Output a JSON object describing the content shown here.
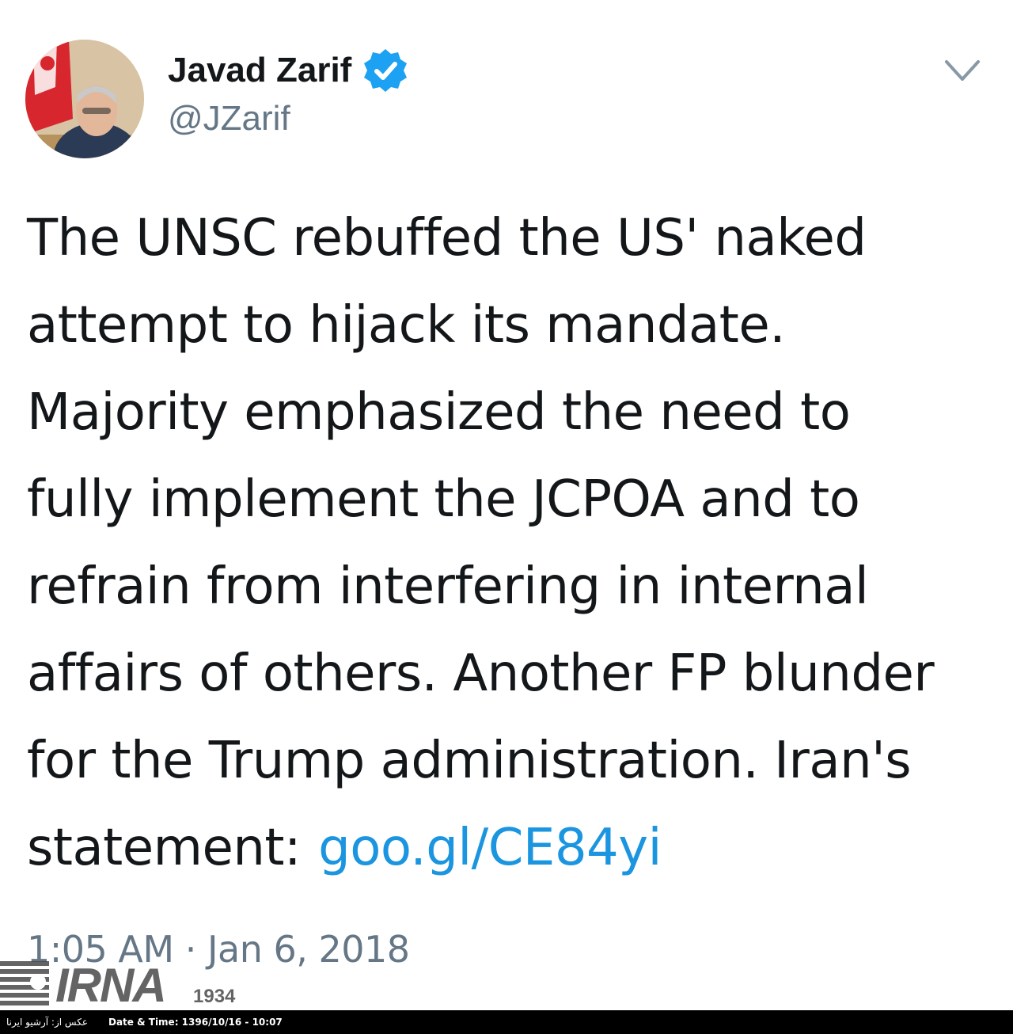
{
  "user": {
    "display_name": "Javad Zarif",
    "handle": "@JZarif",
    "verified": true,
    "avatar_icon": "profile-photo",
    "verified_color": "#1da1f2"
  },
  "menu": {
    "icon": "chevron-down-icon"
  },
  "tweet": {
    "lines": [
      "The UNSC rebuffed the US' naked",
      "attempt to hijack its mandate.",
      "Majority emphasized the need to",
      "fully implement the JCPOA and to",
      "refrain from interfering in internal",
      "affairs of others. Another FP blunder",
      "for the Trump administration. Iran's"
    ],
    "last_line_text": "statement:",
    "link_text": "goo.gl/CE84yi",
    "timestamp": "1:05 AM · Jan 6, 2018",
    "link_color": "#1b95e0"
  },
  "watermark": {
    "brand": "IRNA",
    "year": "1934"
  },
  "footer": {
    "credit": "عکس از: آرشیو ایرنا",
    "datetime": "Date & Time: 1396/10/16 - 10:07"
  }
}
